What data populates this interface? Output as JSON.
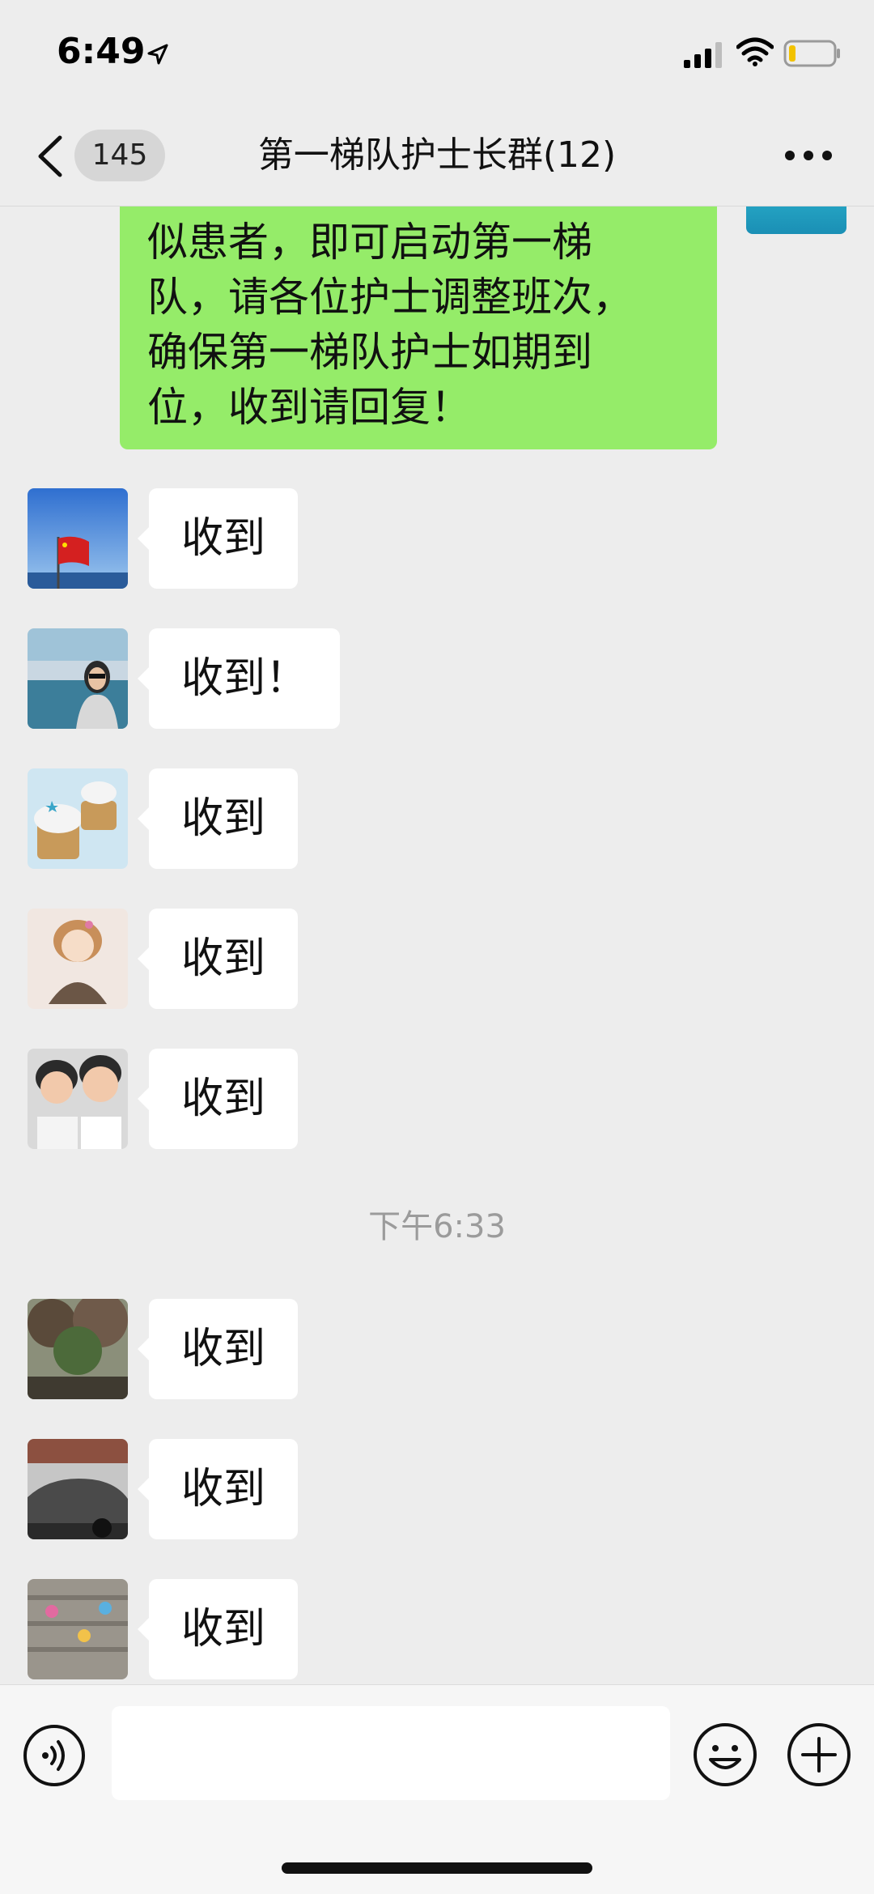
{
  "status_bar": {
    "time": "6:49"
  },
  "nav": {
    "unread_count": "145",
    "title": "第一梯队护士长群(12)"
  },
  "self_message": {
    "text": "似患者，即可启动第一梯\n队，请各位护士调整班次，\n确保第一梯队护士如期到\n位，收到请回复！"
  },
  "messages_before": [
    {
      "text": "收到"
    },
    {
      "text": "收到！"
    },
    {
      "text": "收到"
    },
    {
      "text": "收到"
    },
    {
      "text": "收到"
    }
  ],
  "time_divider": "下午6:33",
  "messages_after": [
    {
      "text": "收到"
    },
    {
      "text": "收到"
    },
    {
      "text": "收到"
    }
  ],
  "colors": {
    "self_bubble": "#95ec69",
    "other_bubble": "#ffffff",
    "background": "#ededed"
  }
}
